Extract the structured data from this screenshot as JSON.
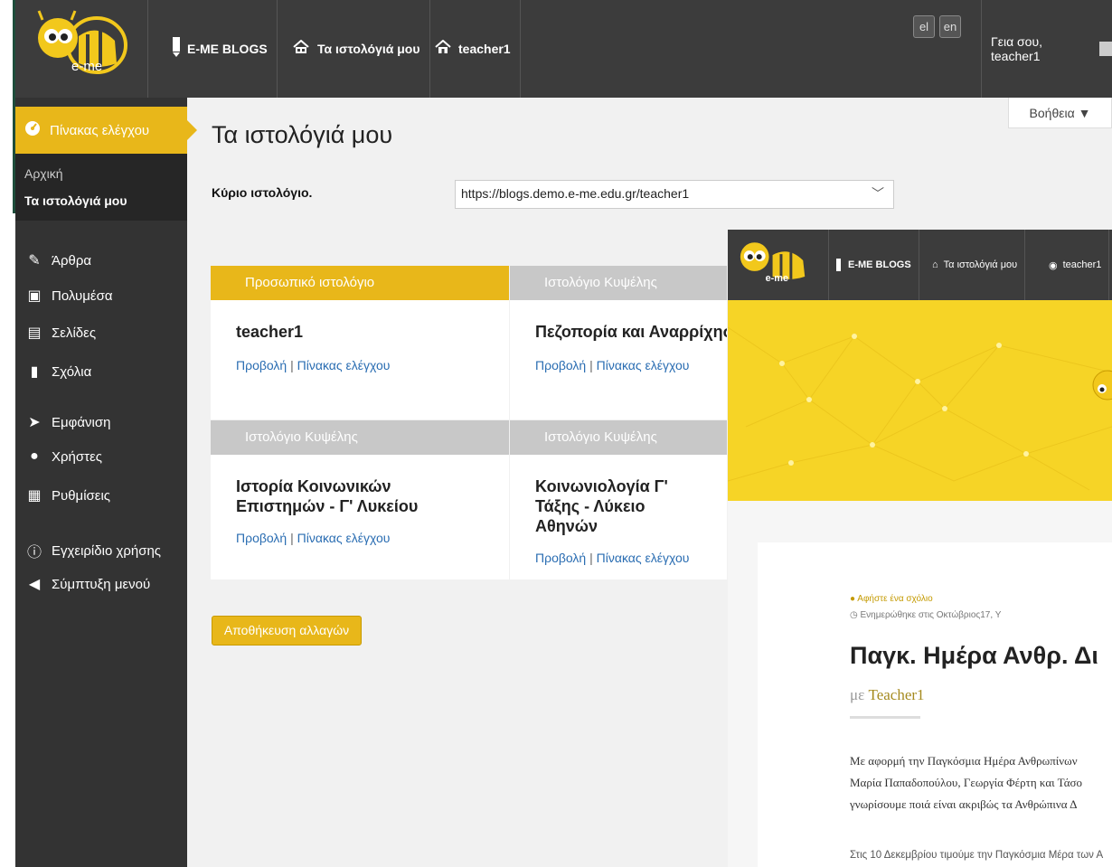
{
  "header": {
    "logo_text": "e-me",
    "nav": [
      {
        "label": "E-ME BLOGS",
        "icon": "pencil-icon"
      },
      {
        "label": "Τα ιστολόγιά μου",
        "icon": "blogs-icon"
      },
      {
        "label": "teacher1",
        "icon": "home-icon"
      }
    ],
    "langs": [
      "el",
      "en"
    ],
    "greeting": "Γεια σου, teacher1"
  },
  "sidebar": {
    "active": "Πίνακας ελέγχου",
    "sub": [
      "Αρχική",
      "Τα ιστολόγιά μου"
    ],
    "items": [
      {
        "label": "Άρθρα",
        "icon": "pin-icon"
      },
      {
        "label": "Πολυμέσα",
        "icon": "media-icon"
      },
      {
        "label": "Σελίδες",
        "icon": "pages-icon"
      },
      {
        "label": "Σχόλια",
        "icon": "comment-icon"
      },
      {
        "label": "Εμφάνιση",
        "icon": "brush-icon"
      },
      {
        "label": "Χρήστες",
        "icon": "user-icon"
      },
      {
        "label": "Ρυθμίσεις",
        "icon": "settings-icon"
      },
      {
        "label": "Εγχειρίδιο χρήσης",
        "icon": "info-icon"
      },
      {
        "label": "Σύμπτυξη μενού",
        "icon": "collapse-icon"
      }
    ]
  },
  "main": {
    "help": "Βοήθεια ▼",
    "title": "Τα ιστολόγιά μου",
    "primary_label": "Κύριο ιστολόγιο.",
    "primary_value": "https://blogs.demo.e-me.edu.gr/teacher1",
    "cards": [
      {
        "head": "Προσωπικό ιστολόγιο",
        "title": "teacher1",
        "view": "Προβολή",
        "sep": "|",
        "dash": "Πίνακας ελέγχου"
      },
      {
        "head": "Ιστολόγιο Κυψέλης",
        "title": "Πεζοπορία και Αναρρίχηση",
        "view": "Προβολή",
        "sep": "|",
        "dash": "Πίνακας ελέγχου"
      },
      {
        "head": "Ιστολόγιο Κυψέλης",
        "title": "Ιστορία Κοινωνικών Επιστημών - Γ' Λυκείου",
        "view": "Προβολή",
        "sep": "|",
        "dash": "Πίνακας ελέγχου"
      },
      {
        "head": "Ιστολόγιο Κυψέλης",
        "title": "Κοινωνιολογία Γ' Τάξης - Λύκειο Αθηνών",
        "view": "Προβολή",
        "sep": "|",
        "dash": "Πίνακας ελέγχου"
      }
    ],
    "save": "Αποθήκευση αλλαγών"
  },
  "overlay": {
    "nav": [
      "E-ME BLOGS",
      "Τα ιστολόγιά μου",
      "teacher1"
    ],
    "comment": "Αφήστε ένα σχόλιο",
    "updated": "Ενημερώθηκε στις Οκτώβριος17, Υ",
    "title": "Παγκ. Ημέρα Ανθρ. Δι",
    "by": "με",
    "author": "Teacher1",
    "p1": "Με αφορμή την Παγκόσμια Ημέρα Ανθρωπίνων",
    "p2": "Μαρία Παπαδοπούλου, Γεωργία Φέρτη και Τάσο",
    "p3": "γνωρίσουμε ποιά είναι ακριβώς τα Ανθρώπινα Δ",
    "p4": "Στις 10 Δεκεμβρίου τιμούμε την Παγκόσμια Μέρα των Α"
  },
  "colors": {
    "accent": "#e8b71a",
    "dark": "#333333",
    "topbar": "#3c3c3c",
    "link": "#2a6db2"
  }
}
